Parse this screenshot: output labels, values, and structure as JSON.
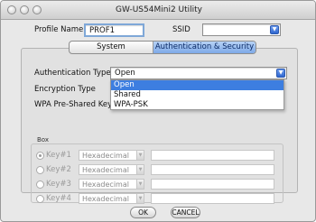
{
  "window": {
    "title": "GW-US54Mini2 Utility"
  },
  "profile": {
    "label": "Profile Name",
    "value": "PROF1"
  },
  "ssid": {
    "label": "SSID",
    "value": ""
  },
  "tabs": [
    {
      "label": "System Configuration",
      "active": false
    },
    {
      "label": "Authentication & Security",
      "active": true
    }
  ],
  "form": {
    "auth_type_label": "Authentication Type",
    "auth_type_value": "Open",
    "encryption_label": "Encryption Type",
    "wpa_psk_label": "WPA Pre-Shared Key"
  },
  "auth_dropdown": {
    "options": [
      "Open",
      "Shared",
      "WPA-PSK"
    ],
    "selected": "Open"
  },
  "wep": {
    "group_label": "Box",
    "keys": [
      {
        "label": "Key#1",
        "format": "Hexadecimal",
        "value": "",
        "selected": true
      },
      {
        "label": "Key#2",
        "format": "Hexadecimal",
        "value": "",
        "selected": false
      },
      {
        "label": "Key#3",
        "format": "Hexadecimal",
        "value": "",
        "selected": false
      },
      {
        "label": "Key#4",
        "format": "Hexadecimal",
        "value": "",
        "selected": false
      }
    ]
  },
  "buttons": {
    "ok": "OK",
    "cancel": "CANCEL"
  },
  "colors": {
    "accent": "#3d7ee0",
    "tab_active": "#7ea9e8",
    "dropdown_button": "#2f66d0"
  },
  "icons": {
    "dropdown": "chevron-down-icon",
    "window_controls": [
      "close-icon",
      "minimize-icon",
      "zoom-icon"
    ]
  }
}
